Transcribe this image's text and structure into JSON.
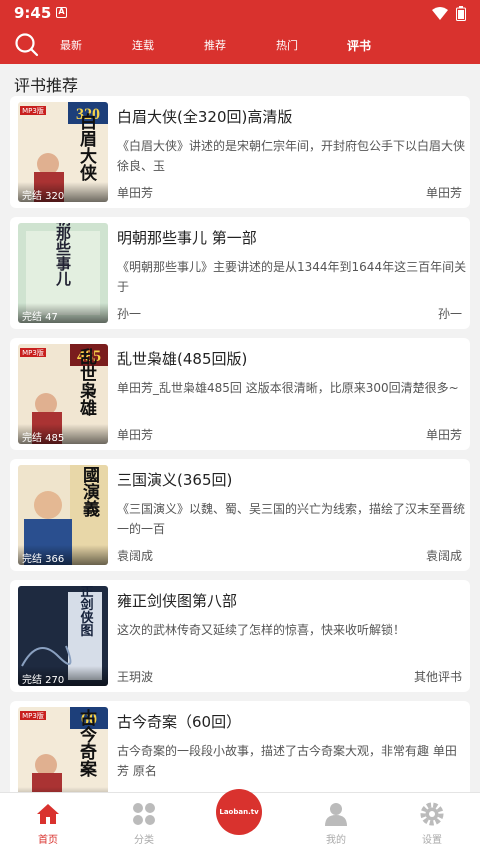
{
  "status": {
    "time": "9:45",
    "a_label": "A"
  },
  "nav": {
    "tabs": [
      {
        "label": "最新"
      },
      {
        "label": "连载"
      },
      {
        "label": "推荐"
      },
      {
        "label": "热门"
      },
      {
        "label": "评书",
        "active": true
      }
    ]
  },
  "section_title": "评书推荐",
  "items": [
    {
      "title": "白眉大侠(全320回)高清版",
      "desc": "《白眉大侠》讲述的是宋朝仁宗年间，开封府包公手下以白眉大侠徐良、玉",
      "author": "单田芳",
      "author_right": "单田芳",
      "badge": "完结 320",
      "cover_number": "320",
      "cover_title": "白眉大侠",
      "cover_tag": "MP3版"
    },
    {
      "title": "明朝那些事儿 第一部",
      "desc": "《明朝那些事儿》主要讲述的是从1344年到1644年这三百年间关于",
      "author": "孙一",
      "author_right": "孙一",
      "badge": "完结 47",
      "cover_title": "明朝那些事儿"
    },
    {
      "title": "乱世枭雄(485回版)",
      "desc": "单田芳_乱世枭雄485回 这版本很清晰，比原来300回清楚很多~",
      "author": "单田芳",
      "author_right": "单田芳",
      "badge": "完结 485",
      "cover_number": "485",
      "cover_title": "乱世枭雄",
      "cover_tag": "MP3版"
    },
    {
      "title": "三国演义(365回)",
      "desc": "《三国演义》以魏、蜀、吴三国的兴亡为线索，描绘了汉末至晋统一的一百",
      "author": "袁阔成",
      "author_right": "袁阔成",
      "badge": "完结 366",
      "cover_title": "三國演義"
    },
    {
      "title": "雍正剑侠图第八部",
      "desc": "这次的武林传奇又延续了怎样的惊喜，快来收听解锁！",
      "author": "王玥波",
      "author_right": "其他评书",
      "badge": "完结 270",
      "cover_title": "雍正剑侠图"
    },
    {
      "title": "古今奇案（60回）",
      "desc": "古今奇案的一段段小故事，描述了古今奇案大观，非常有趣 单田芳 原名",
      "author": "",
      "author_right": "",
      "badge": "",
      "cover_number": "60",
      "cover_title": "古今奇案",
      "cover_tag": "MP3版"
    }
  ],
  "bottom_nav": [
    {
      "label": "首页",
      "icon": "home-icon",
      "active": true
    },
    {
      "label": "分类",
      "icon": "grid-icon"
    },
    {
      "label": "Laoban.tv",
      "icon": "logo"
    },
    {
      "label": "我的",
      "icon": "person-icon"
    },
    {
      "label": "设置",
      "icon": "gear-icon"
    }
  ],
  "colors": {
    "accent": "#d9322e"
  }
}
